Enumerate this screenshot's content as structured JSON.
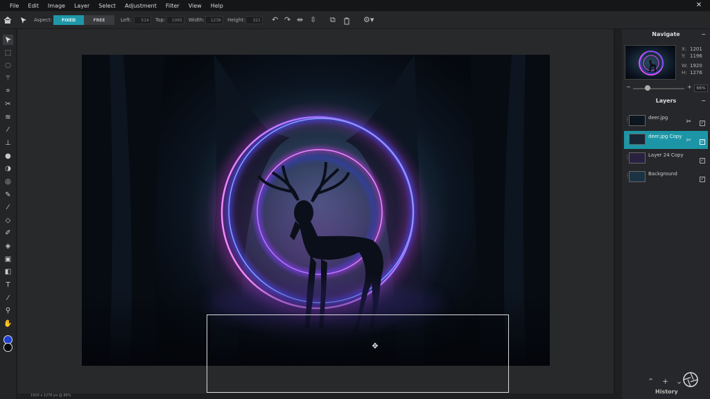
{
  "menu": [
    "File",
    "Edit",
    "Image",
    "Layer",
    "Select",
    "Adjustment",
    "Filter",
    "View",
    "Help"
  ],
  "window": {
    "close_glyph": "✕"
  },
  "toolbar": {
    "aspect_label": "Aspect:",
    "fixed_label": "FIXED",
    "free_label": "FREE",
    "left_label": "Left:",
    "left_value": "514",
    "top_label": "Top:",
    "top_value": "1065",
    "width_label": "Width:",
    "width_value": "1236",
    "height_label": "Height:",
    "height_value": "321"
  },
  "tools": [
    "move-icon",
    "marquee-icon",
    "lasso-icon",
    "magic-wand-icon",
    "crop-icon",
    "scissors-icon",
    "liquify-icon",
    "eyedropper-icon",
    "clone-stamp-icon",
    "blur-icon",
    "sponge-icon",
    "dodge-icon",
    "pen-icon",
    "brush-icon",
    "eraser-icon",
    "pencil-icon",
    "bucket-icon",
    "gradient-icon",
    "shape-icon",
    "type-icon",
    "color-picker-icon",
    "zoom-icon",
    "hand-icon"
  ],
  "colors": {
    "primary": "#1d3fd4",
    "secondary": "#0a0a0a",
    "accent": "#1c96a6"
  },
  "navigate": {
    "title": "Navigate",
    "x_label": "X:",
    "x_value": "1201",
    "y_label": "Y:",
    "y_value": "1196",
    "w_label": "W:",
    "w_value": "1920",
    "h_label": "H:",
    "h_value": "1276",
    "zoom_value": "66%"
  },
  "layers": {
    "title": "Layers",
    "items": [
      {
        "name": "deer.jpg"
      },
      {
        "name": "deer.jpg Copy"
      },
      {
        "name": "Layer 24 Copy"
      },
      {
        "name": "Background"
      }
    ]
  },
  "history_label": "History",
  "status_text": "1920 x 1276 px @ 66%"
}
